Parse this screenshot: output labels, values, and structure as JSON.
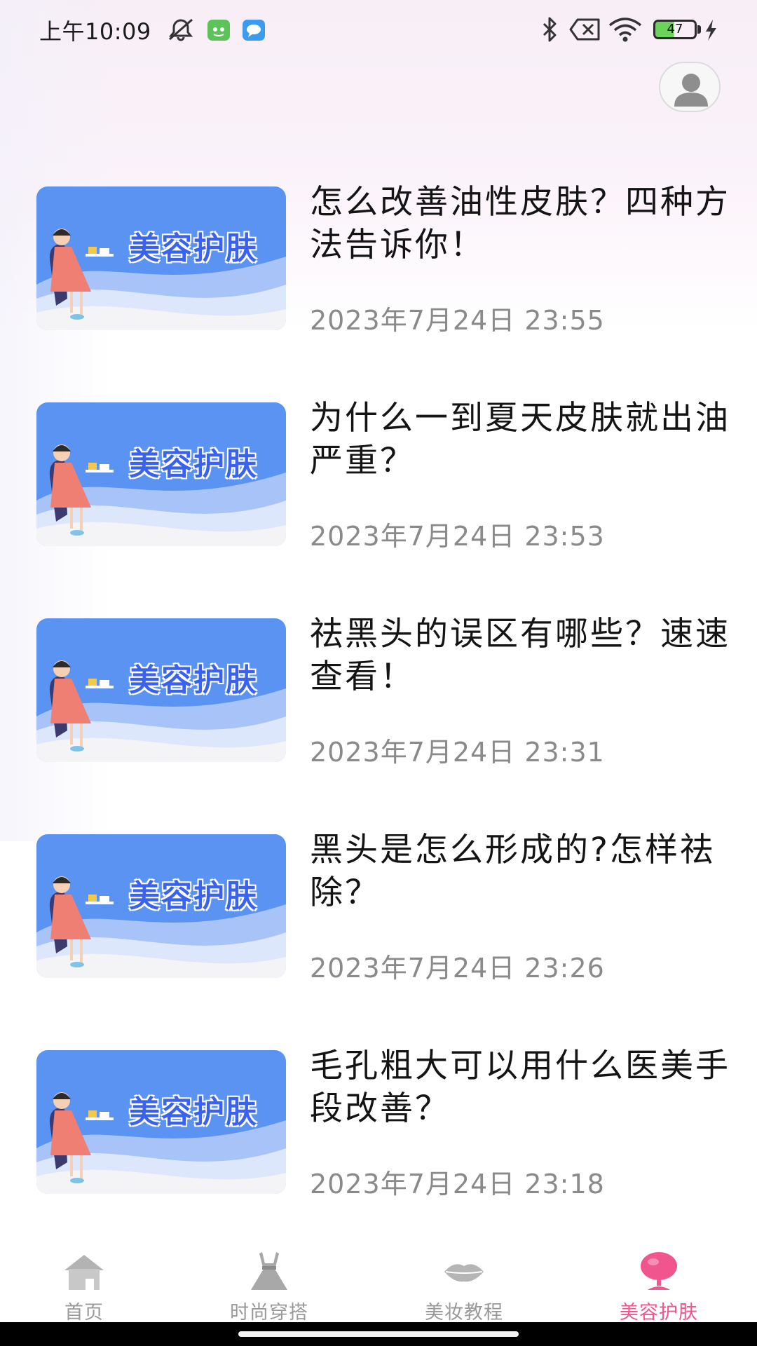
{
  "status_bar": {
    "time": "上午10:09",
    "battery_level": "47",
    "icons": [
      "mute-icon",
      "app-notification-icon",
      "message-notification-icon",
      "bluetooth-icon",
      "sim-error-icon",
      "wifi-icon",
      "battery-icon",
      "charging-icon"
    ]
  },
  "header": {
    "avatar_icon": "user-avatar-icon"
  },
  "articles": [
    {
      "title": "怎么改善油性皮肤？四种方法告诉你！",
      "date": "2023年7月24日 23:55",
      "thumb_text": "美容护肤"
    },
    {
      "title": "为什么一到夏天皮肤就出油严重？",
      "date": "2023年7月24日 23:53",
      "thumb_text": "美容护肤"
    },
    {
      "title": "祛黑头的误区有哪些？速速查看！",
      "date": "2023年7月24日 23:31",
      "thumb_text": "美容护肤"
    },
    {
      "title": "黑头是怎么形成的?怎样祛除？",
      "date": "2023年7月24日 23:26",
      "thumb_text": "美容护肤"
    },
    {
      "title": "毛孔粗大可以用什么医美手段改善？",
      "date": "2023年7月24日 23:18",
      "thumb_text": "美容护肤"
    }
  ],
  "bottom_nav": {
    "items": [
      {
        "label": "首页",
        "icon": "home-icon"
      },
      {
        "label": "时尚穿搭",
        "icon": "dress-icon"
      },
      {
        "label": "美妆教程",
        "icon": "lips-icon"
      },
      {
        "label": "美容护肤",
        "icon": "mirror-icon"
      }
    ],
    "active_index": 3,
    "active_color": "#f0558d",
    "inactive_color": "#999999"
  },
  "colors": {
    "thumb_blue": "#5b93f2",
    "thumb_text": "#3a62f0",
    "date_gray": "#8a8a8a"
  }
}
